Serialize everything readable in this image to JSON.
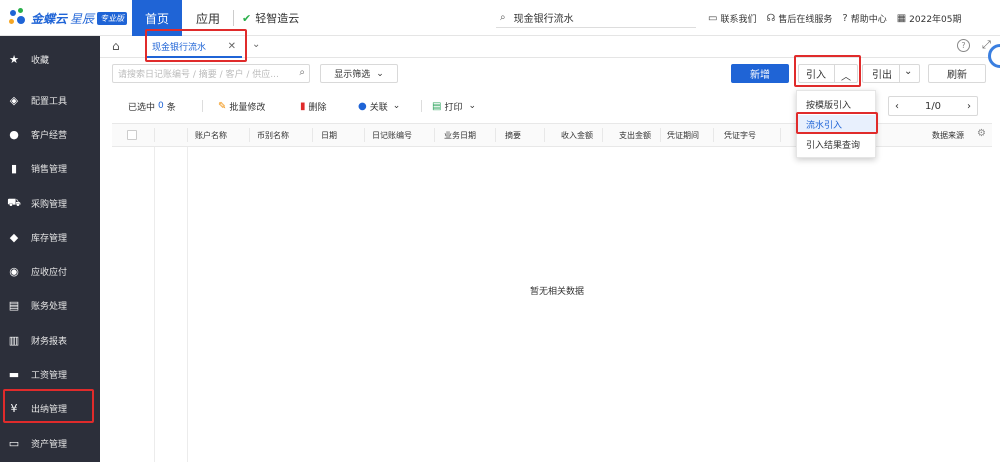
{
  "app": {
    "logo_main": "金蝶云",
    "logo_sub": "星辰",
    "logo_badge": "专业版"
  },
  "nav": {
    "home": "首页",
    "app": "应用",
    "qingzhi": "轻智造云"
  },
  "top_search": {
    "value": "现金银行流水"
  },
  "top_links": [
    "联系我们",
    "售后在线服务",
    "帮助中心",
    "2022年05期"
  ],
  "sidebar": {
    "items": [
      {
        "label": "收藏",
        "icon": "star-icon"
      },
      {
        "label": "配置工具",
        "icon": "layers-icon"
      },
      {
        "label": "客户经营",
        "icon": "user-icon"
      },
      {
        "label": "销售管理",
        "icon": "bar-chart-icon"
      },
      {
        "label": "采购管理",
        "icon": "cart-icon"
      },
      {
        "label": "库存管理",
        "icon": "box-icon"
      },
      {
        "label": "应收应付",
        "icon": "coin-icon"
      },
      {
        "label": "账务处理",
        "icon": "ledger-icon"
      },
      {
        "label": "财务报表",
        "icon": "report-icon"
      },
      {
        "label": "工资管理",
        "icon": "wallet-icon"
      },
      {
        "label": "出纳管理",
        "icon": "cashier-icon"
      },
      {
        "label": "资产管理",
        "icon": "asset-icon"
      }
    ]
  },
  "tabs": {
    "active": "现金银行流水"
  },
  "toolbar": {
    "search_placeholder": "请搜索日记账编号 / 摘要 / 客户 / 供应...",
    "filter_label": "显示筛选",
    "new_label": "新增",
    "import_label": "引入",
    "export_label": "引出",
    "refresh_label": "刷新"
  },
  "actions": {
    "selected_prefix": "已选中",
    "selected_count": "0",
    "selected_suffix": "条",
    "batch_edit": "批量修改",
    "delete": "删除",
    "link": "关联",
    "print": "打印"
  },
  "pager": {
    "text": "1/0"
  },
  "table": {
    "columns": [
      "账户名称",
      "币别名称",
      "日期",
      "日记账编号",
      "业务日期",
      "摘要",
      "收入金额",
      "支出金额",
      "凭证期间",
      "凭证字号",
      "数据来源"
    ],
    "empty_text": "暂无相关数据"
  },
  "import_menu": {
    "items": [
      "按模版引入",
      "流水引入",
      "引入结果查询"
    ],
    "active_index": 1
  },
  "colors": {
    "primary": "#1f64d6",
    "sidebar_bg": "#2c2f3a",
    "highlight": "#e02b2b"
  }
}
